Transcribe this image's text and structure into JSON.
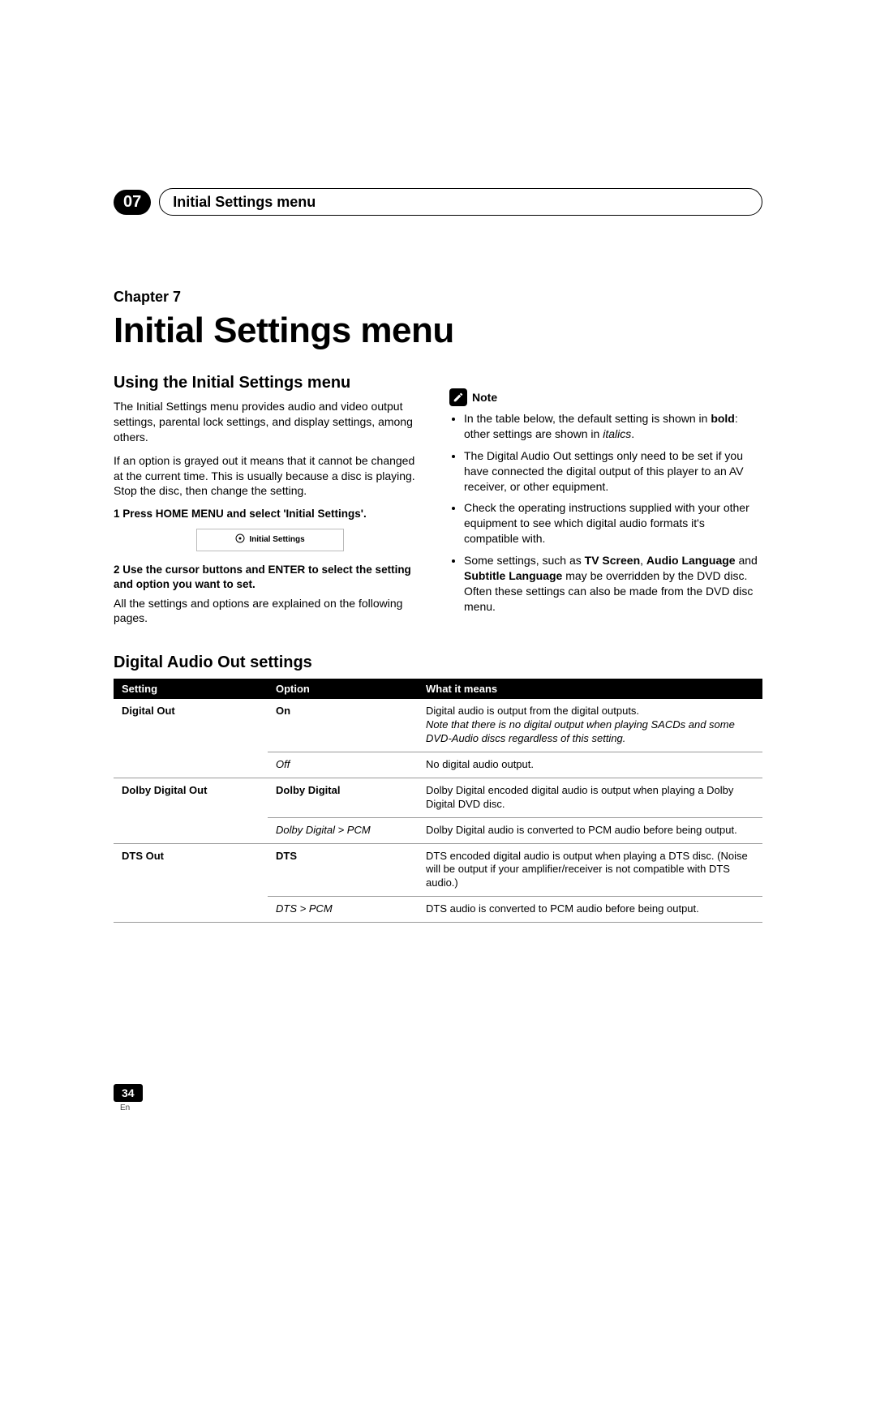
{
  "header": {
    "chapter_badge": "07",
    "title": "Initial Settings menu"
  },
  "chapter": {
    "label": "Chapter 7",
    "title": "Initial Settings menu"
  },
  "left": {
    "h2": "Using the Initial Settings menu",
    "p1": "The Initial Settings menu provides audio and video output settings, parental lock settings, and display settings, among others.",
    "p2": "If an option is grayed out it means that it cannot be changed at the current time. This is usually because a disc is playing. Stop the disc, then change the setting.",
    "step1": "1   Press HOME MENU and select 'Initial Settings'.",
    "img_label": "Initial Settings",
    "step2": "2   Use the cursor buttons and ENTER to select the setting and option you want to set.",
    "p3": "All the settings and options are explained on the following pages."
  },
  "right": {
    "note_label": "Note",
    "n1_a": "In the table below, the default setting is shown in ",
    "n1_bold": "bold",
    "n1_b": ": other settings are shown in ",
    "n1_ital": "italics",
    "n1_c": ".",
    "n2": "The Digital Audio Out settings only need to be set if you have connected the digital output of this player to an AV receiver, or other equipment.",
    "n3": "Check the operating instructions supplied with your other equipment to see which digital audio formats it's compatible with.",
    "n4_a": "Some settings, such as ",
    "n4_b1": "TV Screen",
    "n4_sep1": ", ",
    "n4_b2": "Audio Language",
    "n4_sep2": " and ",
    "n4_b3": "Subtitle Language",
    "n4_c": " may be overridden by the DVD disc. Often these settings can also be made from the DVD disc menu."
  },
  "table": {
    "h2": "Digital Audio Out settings",
    "headers": {
      "setting": "Setting",
      "option": "Option",
      "mean": "What it means"
    },
    "rows": [
      {
        "setting": "Digital Out",
        "option": "On",
        "option_style": "bold",
        "mean_a": "Digital audio is output from the digital outputs.",
        "mean_ital": "Note that there is no digital output when playing SACDs and some DVD-Audio discs regardless of this setting.",
        "border": "br"
      },
      {
        "setting": "",
        "option": "Off",
        "option_style": "ital",
        "mean_a": "No digital audio output.",
        "border": "full"
      },
      {
        "setting": "Dolby Digital Out",
        "option": "Dolby Digital",
        "option_style": "bold",
        "mean_a": "Dolby Digital encoded digital audio is output when playing a Dolby Digital DVD disc.",
        "border": "br"
      },
      {
        "setting": "",
        "option": "Dolby Digital > PCM",
        "option_style": "ital",
        "mean_a": "Dolby Digital audio is converted to PCM audio before being output.",
        "border": "full"
      },
      {
        "setting": "DTS Out",
        "option": "DTS",
        "option_style": "bold",
        "mean_a": "DTS encoded digital audio is output when playing a DTS disc. (Noise will be output if your amplifier/receiver is not compatible with DTS audio.)",
        "border": "br"
      },
      {
        "setting": "",
        "option": "DTS > PCM",
        "option_style": "ital",
        "mean_a": "DTS audio is converted to PCM audio before being output.",
        "border": "full"
      }
    ]
  },
  "footer": {
    "page": "34",
    "lang": "En"
  }
}
